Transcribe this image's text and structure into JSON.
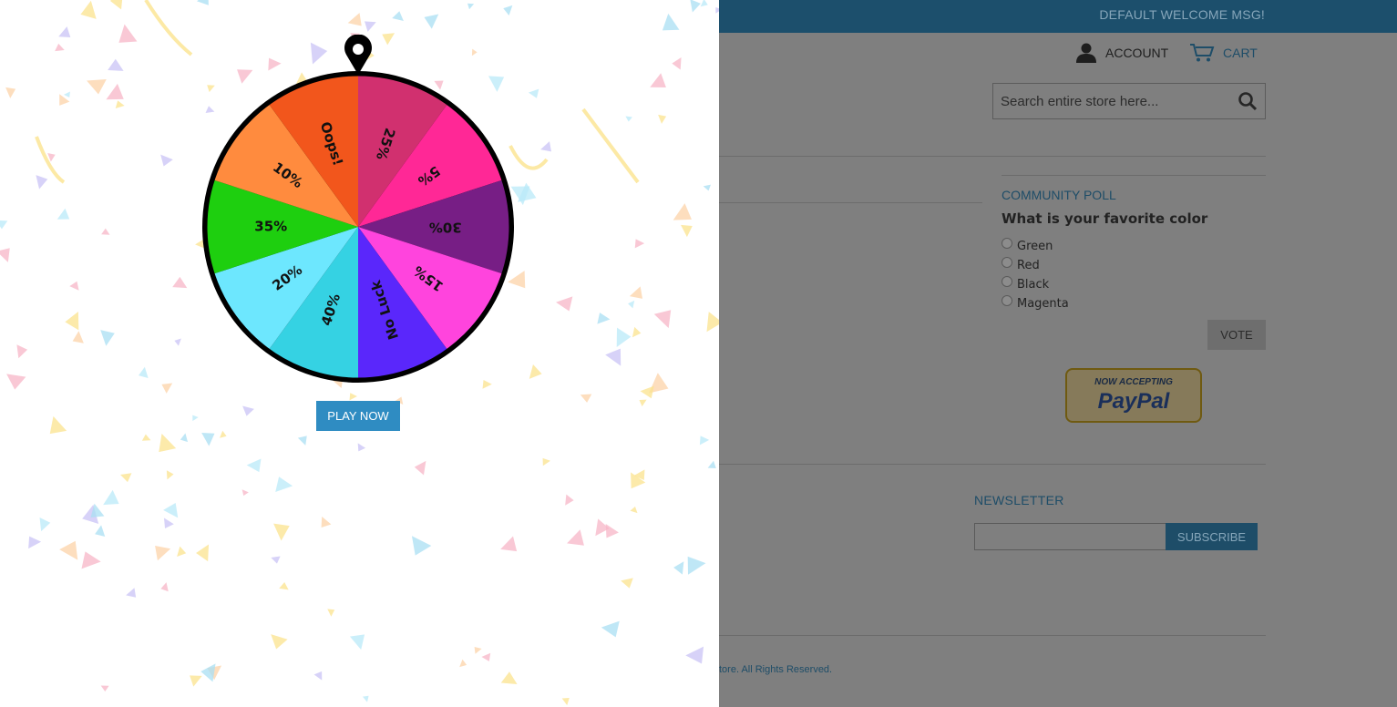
{
  "header": {
    "welcome": "DEFAULT WELCOME MSG!",
    "account_label": "ACCOUNT",
    "cart_label": "CART",
    "search_placeholder": "Search entire store here..."
  },
  "poll": {
    "title": "COMMUNITY POLL",
    "question": "What is your favorite color",
    "options": [
      "Green",
      "Red",
      "Black",
      "Magenta"
    ],
    "vote_label": "VOTE"
  },
  "paypal": {
    "line1": "NOW ACCEPTING",
    "line2": "PayPal"
  },
  "newsletter": {
    "title": "NEWSLETTER",
    "subscribe_label": "SUBSCRIBE"
  },
  "footer": {
    "copyright": "tore. All Rights Reserved."
  },
  "wheel": {
    "segments": [
      {
        "label": "25%",
        "color": "#d1306f"
      },
      {
        "label": "5%",
        "color": "#ff2896"
      },
      {
        "label": "30%",
        "color": "#771e85"
      },
      {
        "label": "15%",
        "color": "#ff44dd"
      },
      {
        "label": "No Luck",
        "color": "#5a27fb"
      },
      {
        "label": "40%",
        "color": "#35d2e3"
      },
      {
        "label": "20%",
        "color": "#6de7fe"
      },
      {
        "label": "35%",
        "color": "#1ecf0f"
      },
      {
        "label": "10%",
        "color": "#ff8b3e"
      },
      {
        "label": "Oops!",
        "color": "#f2561c"
      }
    ],
    "play_label": "PLAY NOW"
  },
  "colors": {
    "brand_blue": "#2f8cc2",
    "confetti": [
      "#f7b6c7",
      "#a9dff3",
      "#fbe38e",
      "#c9c3f5",
      "#fcd3a8",
      "#b9e9f8"
    ]
  }
}
